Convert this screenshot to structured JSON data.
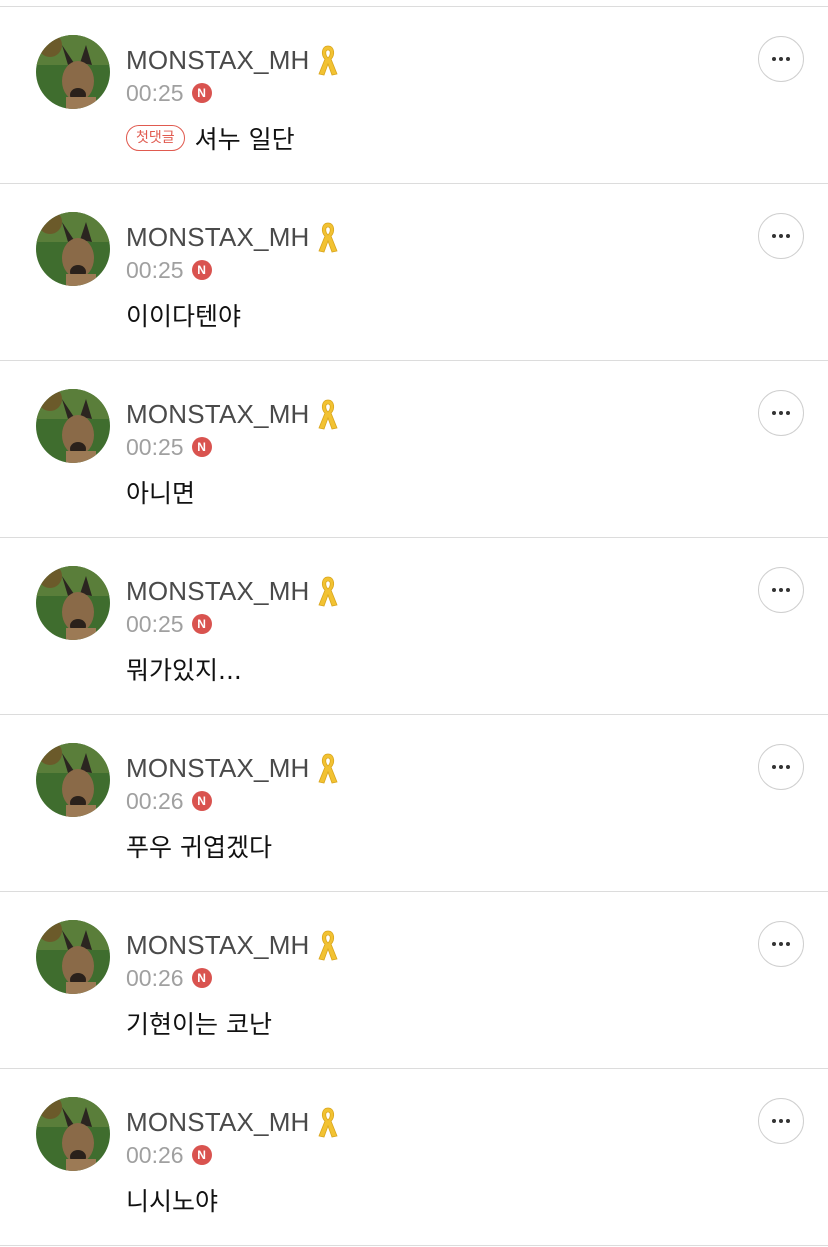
{
  "comments": [
    {
      "username": "MONSTAX_MH",
      "time": "00:25",
      "new_badge": "N",
      "first_tag": "첫댓글",
      "text": "셔누 일단"
    },
    {
      "username": "MONSTAX_MH",
      "time": "00:25",
      "new_badge": "N",
      "text": "이이다텐야"
    },
    {
      "username": "MONSTAX_MH",
      "time": "00:25",
      "new_badge": "N",
      "text": "아니면"
    },
    {
      "username": "MONSTAX_MH",
      "time": "00:25",
      "new_badge": "N",
      "text": "뭐가있지..."
    },
    {
      "username": "MONSTAX_MH",
      "time": "00:26",
      "new_badge": "N",
      "text": "푸우 귀엽겠다"
    },
    {
      "username": "MONSTAX_MH",
      "time": "00:26",
      "new_badge": "N",
      "text": "기현이는 코난"
    },
    {
      "username": "MONSTAX_MH",
      "time": "00:26",
      "new_badge": "N",
      "text": "니시노야"
    }
  ],
  "icons": {
    "ribbon": "yellow-ribbon-icon",
    "more": "more-options-icon",
    "avatar": "dog-avatar"
  },
  "colors": {
    "new_badge": "#d9534f",
    "first_tag": "#e05a4f",
    "ribbon": "#f2c232",
    "username": "#4a4a4a",
    "time": "#a0a0a0"
  }
}
